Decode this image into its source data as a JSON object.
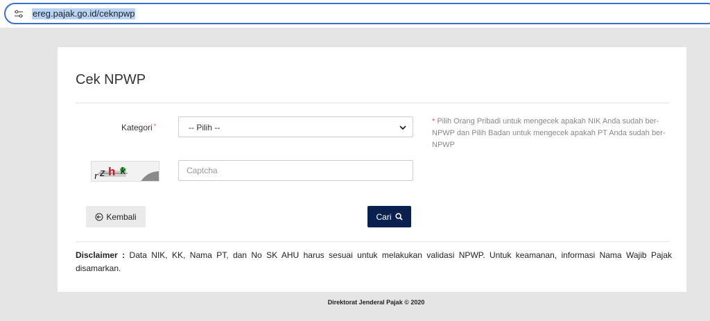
{
  "browser": {
    "url": "ereg.pajak.go.id/ceknpwp",
    "site_settings_icon": "tune-icon"
  },
  "page": {
    "title": "Cek NPWP"
  },
  "form": {
    "kategori_label": "Kategori",
    "required_mark": "*",
    "kategori_selected": "-- Pilih --",
    "hint_star": "*",
    "hint_text": "Pilih Orang Pribadi untuk mengecek apakah NIK Anda sudah ber-NPWP dan Pilih Badan untuk mengecek apakah PT Anda sudah ber-NPWP",
    "captcha_placeholder": "Captcha",
    "captcha_image_text": "rzhk"
  },
  "buttons": {
    "back_label": "Kembali",
    "back_icon": "arrow-left-circle-icon",
    "search_label": "Cari",
    "search_icon": "search-icon",
    "search_color": "#0a2150"
  },
  "disclaimer": {
    "heading": "Disclaimer :",
    "text": "Data NIK, KK, Nama PT, dan No SK AHU harus sesuai untuk melakukan validasi NPWP. Untuk keamanan, informasi Nama Wajib Pajak disamarkan."
  },
  "footer": {
    "text": "Direktorat Jenderal Pajak © 2020"
  }
}
